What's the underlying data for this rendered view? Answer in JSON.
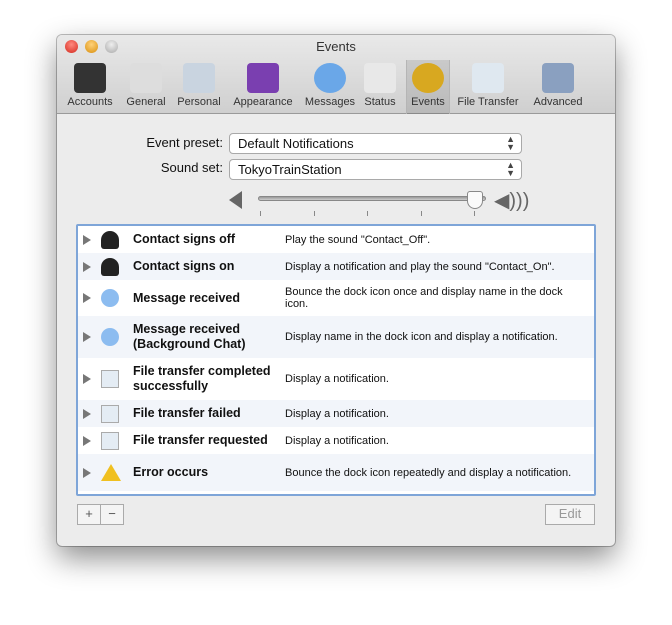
{
  "window": {
    "title": "Events"
  },
  "toolbar": {
    "items": [
      {
        "label": "Accounts",
        "icon": "accounts-icon"
      },
      {
        "label": "General",
        "icon": "general-icon"
      },
      {
        "label": "Personal",
        "icon": "personal-icon"
      },
      {
        "label": "Appearance",
        "icon": "appearance-icon"
      },
      {
        "label": "Messages",
        "icon": "messages-icon"
      },
      {
        "label": "Status",
        "icon": "status-icon"
      },
      {
        "label": "Events",
        "icon": "bell-icon",
        "selected": true
      },
      {
        "label": "File Transfer",
        "icon": "file-transfer-icon"
      },
      {
        "label": "Advanced",
        "icon": "gear-icon"
      }
    ]
  },
  "form": {
    "preset_label": "Event preset:",
    "preset_value": "Default Notifications",
    "sound_label": "Sound set:",
    "sound_value": "TokyoTrainStation",
    "volume": 0.95
  },
  "events": [
    {
      "name": "Contact signs off",
      "desc": "Play the sound \"Contact_Off\".",
      "icon": "person-icon"
    },
    {
      "name": "Contact signs on",
      "desc": "Display a notification and play the sound \"Contact_On\".",
      "icon": "person-icon"
    },
    {
      "name": "Message received",
      "desc": "Bounce the dock icon once and display name in the dock icon.",
      "icon": "chat-bubble-icon"
    },
    {
      "name": "Message received (Background Chat)",
      "desc": "Display name in the dock icon and display a notification.",
      "icon": "chat-bubble-icon"
    },
    {
      "name": "File transfer completed successfully",
      "desc": "Display a notification.",
      "icon": "file-transfer-icon"
    },
    {
      "name": "File transfer failed",
      "desc": "Display a notification.",
      "icon": "file-transfer-icon"
    },
    {
      "name": "File transfer requested",
      "desc": "Display a notification.",
      "icon": "file-transfer-icon"
    },
    {
      "name": "Error occurs",
      "desc": "Bounce the dock icon repeatedly and display a notification.",
      "icon": "warning-icon"
    }
  ],
  "buttons": {
    "add": "+",
    "remove": "−",
    "edit": "Edit"
  },
  "colors": {
    "selection_border": "#7ea5d8",
    "alt_row": "#f2f5fa"
  }
}
